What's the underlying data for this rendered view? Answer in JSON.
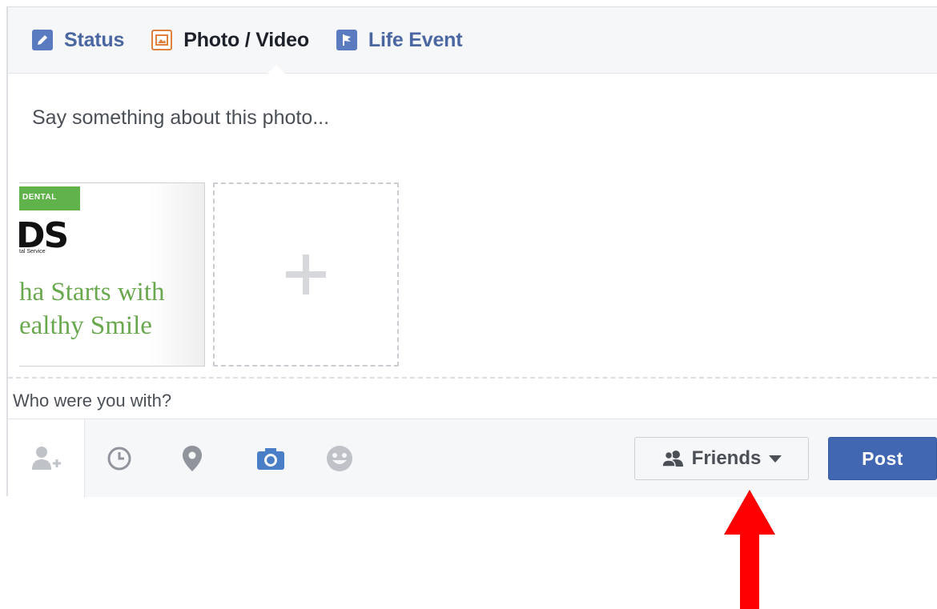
{
  "tabs": [
    {
      "label": "Status",
      "icon": "pencil-icon",
      "color": "#4b67a1"
    },
    {
      "label": "Photo / Video",
      "icon": "photo-icon",
      "color": "#e0803e"
    },
    {
      "label": "Life Event",
      "icon": "flag-icon",
      "color": "#4b67a1"
    }
  ],
  "composer": {
    "say_something": "Say something about this photo..."
  },
  "thumbnail": {
    "banner": "DENTAL",
    "logo": "DS",
    "small": "tal Service",
    "line1": "ha Starts with",
    "line2": "ealthy Smile"
  },
  "with_field": {
    "placeholder": "Who were you with?"
  },
  "footer": {
    "icons": [
      "tag-friends-icon",
      "clock-icon",
      "location-pin-icon",
      "camera-icon",
      "feeling-smiley-icon"
    ],
    "audience_label": "Friends",
    "post_label": "Post"
  },
  "colors": {
    "post_button": "#4267b2",
    "arrow": "#ff0000",
    "thumbnail_text": "#6aa84f"
  }
}
